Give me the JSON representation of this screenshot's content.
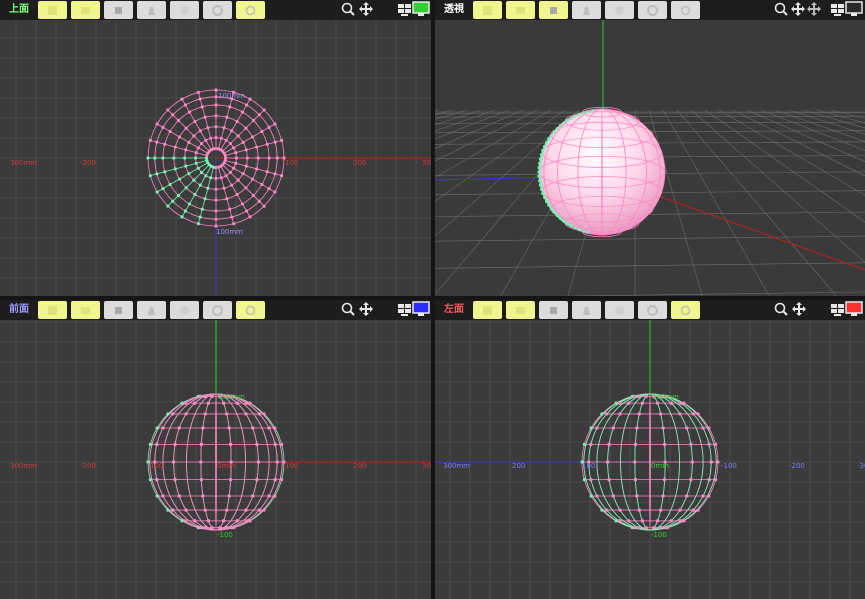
{
  "viewports": {
    "top": {
      "title": "上面",
      "title_color": "#7dff7d",
      "monitor_color": "#2fd02f",
      "axis_labels": [
        "300mm",
        "-200",
        "100",
        "200",
        "30",
        "100mm",
        "100mm"
      ]
    },
    "persp": {
      "title": "透視",
      "title_color": "#ffffff"
    },
    "front": {
      "title": "前面",
      "title_color": "#9b9bff",
      "monitor_color": "#2c2cff",
      "axis_labels": [
        "300mm",
        "-200",
        "100",
        "0mm",
        "100",
        "200",
        "30",
        "100mm",
        "-100"
      ]
    },
    "left": {
      "title": "左面",
      "title_color": "#ff5a5a",
      "monitor_color": "#ff3030",
      "axis_labels": [
        "300mm",
        "200",
        "100",
        "0mm",
        "-100",
        "-200",
        "-30",
        "100mm",
        "-100"
      ]
    }
  },
  "toolbar_icons": [
    "move-tool",
    "rotate-tool",
    "cube-tool",
    "bell-tool",
    "sphere-tool",
    "gear-tool",
    "refresh-tool"
  ],
  "colors": {
    "grid": "#595959",
    "x_axis": "#c81e1e",
    "y_axis": "#2ec92e",
    "z_axis": "#3a3acf",
    "mesh_pink": "#ff86c4",
    "mesh_green": "#7af0b4",
    "button_yellow": "#f1f590"
  }
}
